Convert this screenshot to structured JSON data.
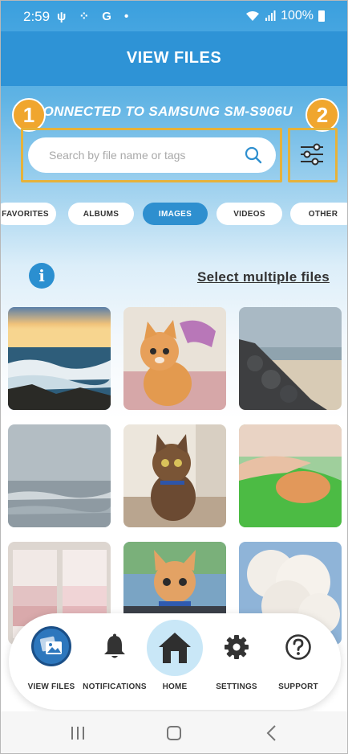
{
  "status_bar": {
    "time": "2:59",
    "left_icons": "ψ ⁘ G •",
    "battery": "100%"
  },
  "header": {
    "title": "VIEW FILES"
  },
  "connection": {
    "text": "CONNECTED TO SAMSUNG SM-S906U"
  },
  "callouts": [
    "1",
    "2"
  ],
  "search": {
    "placeholder": "Search by file name or tags",
    "value": ""
  },
  "tabs": [
    {
      "label": "FAVORITES",
      "active": false
    },
    {
      "label": "ALBUMS",
      "active": false
    },
    {
      "label": "IMAGES",
      "active": true
    },
    {
      "label": "VIDEOS",
      "active": false
    },
    {
      "label": "OTHER",
      "active": false
    }
  ],
  "info_icon": "i",
  "select_multiple_label": "Select multiple files",
  "images": [
    {
      "subject": "ocean waves at sunset"
    },
    {
      "subject": "orange kitten with toy"
    },
    {
      "subject": "rocky jetty beach"
    },
    {
      "subject": "foggy sea"
    },
    {
      "subject": "tabby cat on counter"
    },
    {
      "subject": "kitten sleeping on green blanket"
    },
    {
      "subject": "paint swatch cards"
    },
    {
      "subject": "orange kitten in car"
    },
    {
      "subject": "white blossom tree"
    }
  ],
  "bottom_nav": [
    {
      "label": "VIEW FILES",
      "icon": "images-icon",
      "active": true
    },
    {
      "label": "NOTIFICATIONS",
      "icon": "bell-icon",
      "active": false
    },
    {
      "label": "HOME",
      "icon": "home-icon",
      "active": false
    },
    {
      "label": "SETTINGS",
      "icon": "gear-icon",
      "active": false
    },
    {
      "label": "SUPPORT",
      "icon": "help-icon",
      "active": false
    }
  ],
  "colors": {
    "header": "#2e93d6",
    "accent": "#2e8fcf",
    "callout": "#f0a62e",
    "home_circle": "#c9e7f7"
  }
}
